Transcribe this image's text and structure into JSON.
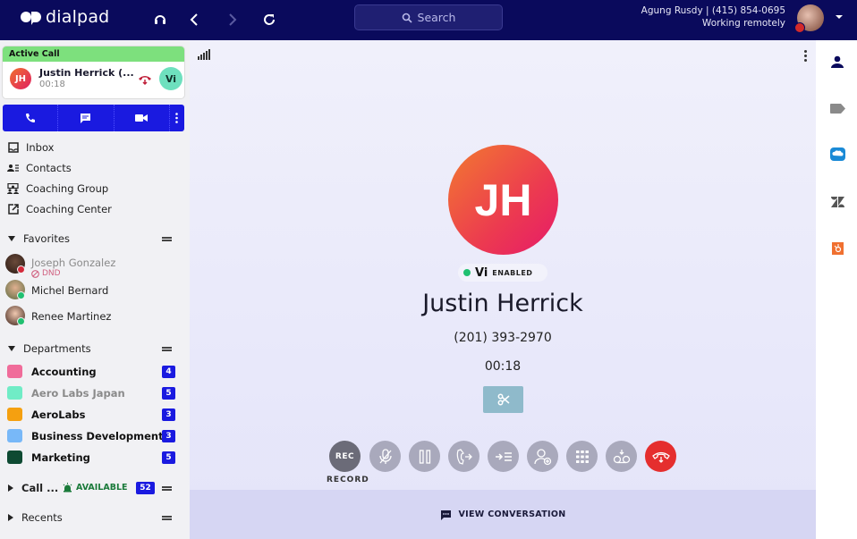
{
  "topbar": {
    "logo_text": "dialpad",
    "search_placeholder": "Search",
    "user_line": "Agung Rusdy | (415) 854-0695",
    "user_status": "Working remotely",
    "icons": [
      "headset-icon",
      "back-icon",
      "forward-icon",
      "refresh-icon",
      "search-icon",
      "chevron-down-icon"
    ]
  },
  "active_call": {
    "header": "Active Call",
    "initials": "JH",
    "name": "Justin Herrick (...",
    "duration": "00:18",
    "vi_label": "Vi"
  },
  "nav": {
    "items": [
      {
        "label": "Inbox",
        "icon": "inbox-icon"
      },
      {
        "label": "Contacts",
        "icon": "contacts-icon"
      },
      {
        "label": "Coaching Group",
        "icon": "coaching-group-icon"
      },
      {
        "label": "Coaching Center",
        "icon": "external-link-icon"
      }
    ]
  },
  "favorites": {
    "title": "Favorites",
    "items": [
      {
        "name": "Joseph Gonzalez",
        "status": "DND",
        "status_color": "#d42a3a"
      },
      {
        "name": "Michel Bernard",
        "status": "available",
        "status_color": "#20c070"
      },
      {
        "name": "Renee Martinez",
        "status": "available",
        "status_color": "#20c070"
      }
    ]
  },
  "departments": {
    "title": "Departments",
    "items": [
      {
        "name": "Accounting",
        "count": "4",
        "color": "#f06c9a",
        "muted": false
      },
      {
        "name": "Aero Labs Japan",
        "count": "5",
        "color": "#70ecc6",
        "muted": true
      },
      {
        "name": "AeroLabs",
        "count": "3",
        "color": "#f5a010",
        "muted": false
      },
      {
        "name": "Business Development",
        "count": "3",
        "color": "#78b8f8",
        "muted": false
      },
      {
        "name": "Marketing",
        "count": "5",
        "color": "#0e4a32",
        "muted": false
      }
    ]
  },
  "call_center": {
    "title": "Call ...",
    "status": "AVAILABLE",
    "count": "52"
  },
  "recents": {
    "title": "Recents"
  },
  "call": {
    "initials": "JH",
    "vi_label": "Vi",
    "vi_status": "ENABLED",
    "name": "Justin Herrick",
    "phone": "(201) 393-2970",
    "timer": "00:18",
    "record_btn": "REC",
    "record_label": "RECORD",
    "controls": [
      "record",
      "mute",
      "hold",
      "transfer",
      "merge",
      "add-caller",
      "keypad",
      "voicemail-drop",
      "hang-up"
    ],
    "view_conversation": "VIEW CONVERSATION"
  },
  "right_sidebar": {
    "icons": [
      "contact-icon",
      "tag-icon",
      "salesforce-icon",
      "zendesk-icon",
      "hubspot-icon"
    ]
  },
  "colors": {
    "brand_nav": "#0a0a5c",
    "accent": "#1a1ae0",
    "active_green": "#7de07d",
    "end_call_red": "#e52e2e"
  }
}
